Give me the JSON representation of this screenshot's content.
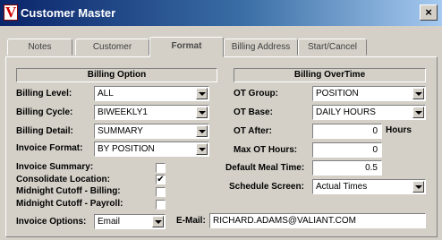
{
  "window": {
    "title": "Customer Master",
    "icon_letter": "V",
    "close_glyph": "×"
  },
  "tabs": [
    {
      "label": "Notes",
      "active": false
    },
    {
      "label": "Customer",
      "active": false
    },
    {
      "label": "Format",
      "active": true
    },
    {
      "label": "Billing Address",
      "active": false
    },
    {
      "label": "Start/Cancel",
      "active": false
    }
  ],
  "billing_option": {
    "header": "Billing Option",
    "billing_level": {
      "label": "Billing Level:",
      "value": "ALL"
    },
    "billing_cycle": {
      "label": "Billing Cycle:",
      "value": "BIWEEKLY1"
    },
    "billing_detail": {
      "label": "Billing Detail:",
      "value": "SUMMARY"
    },
    "invoice_format": {
      "label": "Invoice Format:",
      "value": "BY POSITION"
    },
    "invoice_summary": {
      "label": "Invoice Summary:",
      "checked": false
    },
    "consolidate_location": {
      "label": "Consolidate Location:",
      "checked": true
    },
    "midnight_billing": {
      "label": "Midnight Cutoff - Billing:",
      "checked": false
    },
    "midnight_payroll": {
      "label": "Midnight Cutoff - Payroll:",
      "checked": false
    },
    "invoice_options": {
      "label": "Invoice Options:",
      "value": "Email"
    }
  },
  "billing_overtime": {
    "header": "Billing OverTime",
    "ot_group": {
      "label": "OT Group:",
      "value": "POSITION"
    },
    "ot_base": {
      "label": "OT Base:",
      "value": "DAILY HOURS"
    },
    "ot_after": {
      "label": "OT After:",
      "value": "0",
      "unit": "Hours"
    },
    "max_ot_hours": {
      "label": "Max OT Hours:",
      "value": "0"
    },
    "default_meal_time": {
      "label": "Default Meal Time:",
      "value": "0.5"
    },
    "schedule_screen": {
      "label": "Schedule Screen:",
      "value": "Actual Times"
    },
    "email": {
      "label": "E-Mail:",
      "value": "RICHARD.ADAMS@VALIANT.COM"
    }
  },
  "check_glyph": "✔"
}
